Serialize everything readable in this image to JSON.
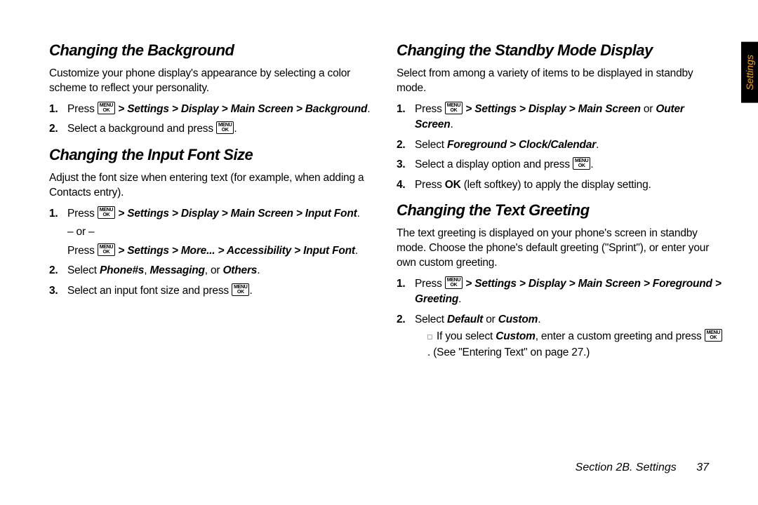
{
  "tab_label": "Settings",
  "footer_section": "Section 2B. Settings",
  "footer_page": "37",
  "key_line1": "MENU",
  "key_line2": "OK",
  "left": {
    "h1": "Changing the Background",
    "p1": "Customize your phone display's appearance by selecting a color scheme to reflect your personality.",
    "s1_prefix": "Press ",
    "s1_path": "> Settings > Display > Main Screen > Background",
    "s1_suffix": ".",
    "s2_prefix": "Select a background and press ",
    "s2_suffix": ".",
    "h2": "Changing the Input Font Size",
    "p2": "Adjust the font size when entering text (for example, when adding a Contacts entry).",
    "s3_prefix": "Press ",
    "s3_path": "> Settings > Display > Main Screen > Input Font",
    "s3_suffix": ".",
    "s3_or": "– or –",
    "s3b_prefix": "Press ",
    "s3b_path": "> Settings > More... > Accessibility > Input Font",
    "s3b_suffix": ".",
    "s4_prefix": "Select ",
    "s4_opt1": "Phone#s",
    "s4_mid1": ", ",
    "s4_opt2": "Messaging",
    "s4_mid2": ", or ",
    "s4_opt3": "Others",
    "s4_suffix": ".",
    "s5_prefix": "Select an input font size and press ",
    "s5_suffix": "."
  },
  "right": {
    "h1": "Changing the Standby Mode Display",
    "p1": "Select from among a variety of items to be displayed in standby mode.",
    "s1_prefix": "Press ",
    "s1_path": "> Settings > Display > Main Screen",
    "s1_or_word": " or ",
    "s1_path2": "Outer Screen",
    "s1_suffix": ".",
    "s2_prefix": "Select ",
    "s2_path": "Foreground > Clock/Calendar",
    "s2_suffix": ".",
    "s3_prefix": "Select a display option and press ",
    "s3_suffix": ".",
    "s4_prefix": "Press ",
    "s4_bold": "OK",
    "s4_mid": " (left softkey) to apply the display setting.",
    "h2": "Changing the Text Greeting",
    "p2": "The text greeting is displayed on your phone's screen in standby mode. Choose the phone's default greeting (\"Sprint\"), or enter your own custom greeting.",
    "s5_prefix": "Press ",
    "s5_path": "> Settings > Display > Main Screen > Foreground > Greeting",
    "s5_suffix": ".",
    "s6_prefix": "Select ",
    "s6_opt1": "Default",
    "s6_mid": " or ",
    "s6_opt2": "Custom",
    "s6_suffix": ".",
    "s6_sub_prefix": "If you select ",
    "s6_sub_bold": "Custom",
    "s6_sub_mid": ", enter a custom greeting and press ",
    "s6_sub_suffix": ". (See \"Entering Text\" on page 27.)"
  }
}
